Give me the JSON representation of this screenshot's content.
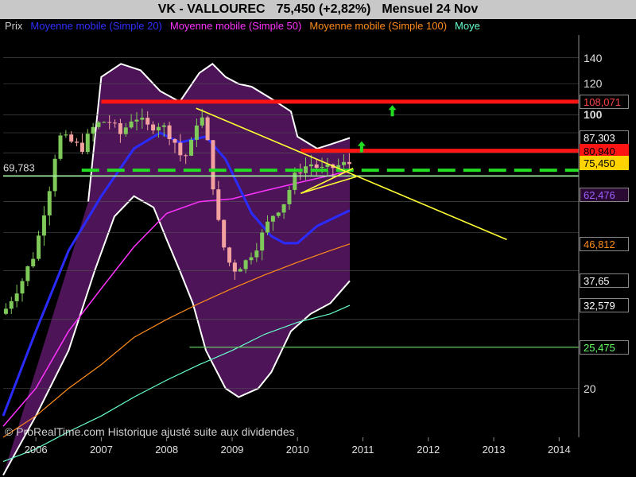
{
  "header": {
    "symbol": "VK - VALLOUREC",
    "price_change": "75,450 (+2,82%)",
    "period": "Mensuel  24 Nov"
  },
  "legend": [
    {
      "label": "Prix",
      "color": "#cccccc"
    },
    {
      "label": "Moyenne mobile (Simple 20)",
      "color": "#3030ff"
    },
    {
      "label": "Moyenne mobile (Simple 50)",
      "color": "#ff33ff"
    },
    {
      "label": "Moyenne mobile (Simple 100)",
      "color": "#ff8c1a"
    },
    {
      "label": "Moye",
      "color": "#66ffcc"
    }
  ],
  "watermark": "© ProRealTime.com Historique ajusté suite aux dividendes",
  "left_level_label": "69,783",
  "colors": {
    "bull": "#7fc85a",
    "bear": "#f2a0a0",
    "bands": "#4d1557",
    "red_line": "#ff1414",
    "green_dash": "#22dd22",
    "trend": "#ffff33"
  },
  "chart_data": {
    "type": "candlestick",
    "title": "VK - VALLOUREC 75,450 (+2,82%) Mensuel 24 Nov",
    "y_scale": "log",
    "ylim": [
      15,
      160
    ],
    "y_ticks": [
      "140",
      "120",
      "100",
      "20"
    ],
    "x_ticks": [
      "2006",
      "2007",
      "2008",
      "2009",
      "2010",
      "2011",
      "2012",
      "2013",
      "2014"
    ],
    "xlim": [
      2005.5,
      2014.3
    ],
    "price_path": [
      [
        2005.5,
        31
      ],
      [
        2005.8,
        38
      ],
      [
        2006.0,
        45
      ],
      [
        2006.2,
        64
      ],
      [
        2006.35,
        88
      ],
      [
        2006.5,
        86
      ],
      [
        2006.7,
        82
      ],
      [
        2006.9,
        94
      ],
      [
        2007.1,
        97
      ],
      [
        2007.3,
        89
      ],
      [
        2007.5,
        100
      ],
      [
        2007.7,
        93
      ],
      [
        2007.9,
        95
      ],
      [
        2008.1,
        87
      ],
      [
        2008.25,
        76
      ],
      [
        2008.4,
        86
      ],
      [
        2008.5,
        103
      ],
      [
        2008.6,
        90
      ],
      [
        2008.75,
        57
      ],
      [
        2008.85,
        47
      ],
      [
        2009.0,
        40
      ],
      [
        2009.2,
        42
      ],
      [
        2009.4,
        47
      ],
      [
        2009.6,
        55
      ],
      [
        2009.8,
        60
      ],
      [
        2010.0,
        72
      ],
      [
        2010.2,
        75
      ],
      [
        2010.4,
        72
      ],
      [
        2010.6,
        74
      ],
      [
        2010.85,
        75.45
      ]
    ],
    "levels": [
      {
        "value": 108.071,
        "label": "108,071",
        "kind": "resistance"
      },
      {
        "value": 80.94,
        "label": "80,940",
        "kind": "resistance"
      },
      {
        "value": 72.2,
        "label": "",
        "kind": "dashed-support"
      },
      {
        "value": 69.783,
        "label": "69,783",
        "kind": "horizontal"
      },
      {
        "value": 25.475,
        "label": "25,475",
        "kind": "support"
      }
    ],
    "price_labels": [
      {
        "label": "87,303",
        "value": 87.303,
        "bg": "#000000",
        "fg": "#ffffff",
        "border": "#888888"
      },
      {
        "label": "80,940",
        "value": 80.94,
        "bg": "#ff1414",
        "fg": "#000000",
        "border": "#ff1414"
      },
      {
        "label": "75,450",
        "value": 75.45,
        "bg": "#ffd300",
        "fg": "#000000",
        "border": "#ffd300"
      },
      {
        "label": "62,476",
        "value": 62.476,
        "bg": "#2a0a33",
        "fg": "#9a60ff",
        "border": "#888888"
      },
      {
        "label": "46,812",
        "value": 46.812,
        "bg": "#000000",
        "fg": "#ff8c1a",
        "border": "#888888"
      },
      {
        "label": "37,65",
        "value": 37.65,
        "bg": "#000000",
        "fg": "#ffffff",
        "border": "#888888"
      },
      {
        "label": "32,579",
        "value": 32.579,
        "bg": "#000000",
        "fg": "#ffffff",
        "border": "#888888"
      },
      {
        "label": "25,475",
        "value": 25.475,
        "bg": "#000000",
        "fg": "#66ff66",
        "border": "#888888"
      }
    ],
    "sma20": [
      [
        2005.5,
        17
      ],
      [
        2006.0,
        28
      ],
      [
        2006.5,
        45
      ],
      [
        2007.0,
        62
      ],
      [
        2007.5,
        82
      ],
      [
        2007.9,
        90
      ],
      [
        2008.2,
        85
      ],
      [
        2008.6,
        88
      ],
      [
        2008.9,
        77
      ],
      [
        2009.3,
        56
      ],
      [
        2009.6,
        49
      ],
      [
        2009.8,
        47
      ],
      [
        2010.0,
        47
      ],
      [
        2010.3,
        52
      ],
      [
        2010.8,
        57
      ]
    ],
    "sma50": [
      [
        2005.5,
        16
      ],
      [
        2006.0,
        20
      ],
      [
        2006.5,
        28
      ],
      [
        2007.0,
        36
      ],
      [
        2007.5,
        46
      ],
      [
        2008.0,
        56
      ],
      [
        2008.5,
        60
      ],
      [
        2009.0,
        61
      ],
      [
        2009.5,
        64
      ],
      [
        2010.0,
        67
      ],
      [
        2010.5,
        70
      ],
      [
        2010.8,
        72
      ]
    ],
    "sma100": [
      [
        2005.5,
        15
      ],
      [
        2006.0,
        17
      ],
      [
        2006.5,
        20
      ],
      [
        2007.0,
        23
      ],
      [
        2007.5,
        27
      ],
      [
        2008.0,
        30
      ],
      [
        2008.5,
        33
      ],
      [
        2009.0,
        36
      ],
      [
        2009.5,
        39
      ],
      [
        2010.0,
        42
      ],
      [
        2010.5,
        45
      ],
      [
        2010.8,
        46.8
      ]
    ],
    "sma200": [
      [
        2005.5,
        13
      ],
      [
        2006.0,
        14
      ],
      [
        2006.5,
        15.5
      ],
      [
        2007.0,
        17
      ],
      [
        2007.5,
        19
      ],
      [
        2008.0,
        21
      ],
      [
        2008.5,
        23
      ],
      [
        2009.0,
        25
      ],
      [
        2009.5,
        27.5
      ],
      [
        2010.0,
        29.5
      ],
      [
        2010.5,
        31
      ],
      [
        2010.8,
        32.6
      ]
    ],
    "bb_upper": [
      [
        2006.8,
        60
      ],
      [
        2007.0,
        125
      ],
      [
        2007.3,
        135
      ],
      [
        2007.6,
        130
      ],
      [
        2007.9,
        115
      ],
      [
        2008.2,
        108
      ],
      [
        2008.5,
        128
      ],
      [
        2008.7,
        135
      ],
      [
        2008.9,
        125
      ],
      [
        2009.1,
        120
      ],
      [
        2009.3,
        118
      ],
      [
        2009.6,
        110
      ],
      [
        2009.9,
        102
      ],
      [
        2010.0,
        88
      ],
      [
        2010.3,
        82
      ],
      [
        2010.5,
        84
      ],
      [
        2010.8,
        87.3
      ]
    ],
    "bb_lower": [
      [
        2005.5,
        12
      ],
      [
        2006.0,
        17
      ],
      [
        2006.5,
        25
      ],
      [
        2006.9,
        40
      ],
      [
        2007.2,
        55
      ],
      [
        2007.5,
        62
      ],
      [
        2007.8,
        58
      ],
      [
        2008.0,
        48
      ],
      [
        2008.2,
        40
      ],
      [
        2008.4,
        33
      ],
      [
        2008.6,
        25
      ],
      [
        2008.9,
        20
      ],
      [
        2009.1,
        19
      ],
      [
        2009.4,
        20
      ],
      [
        2009.6,
        22
      ],
      [
        2009.9,
        28
      ],
      [
        2010.2,
        31
      ],
      [
        2010.5,
        33
      ],
      [
        2010.8,
        37.65
      ]
    ],
    "trendlines": [
      {
        "from": [
          2008.45,
          104
        ],
        "to": [
          2013.2,
          48
        ],
        "color": "#ffff33"
      },
      {
        "from": [
          2010.05,
          63
        ],
        "to": [
          2010.9,
          69.5
        ],
        "color": "#ffff33"
      },
      {
        "from": [
          2010.05,
          63
        ],
        "to": [
          2010.85,
          73
        ],
        "color": "#ffff33"
      }
    ],
    "arrows": [
      {
        "x": 2011.45,
        "y": 102,
        "color": "#22dd22"
      },
      {
        "x": 2010.98,
        "y": 82.5,
        "color": "#22dd22"
      }
    ]
  }
}
